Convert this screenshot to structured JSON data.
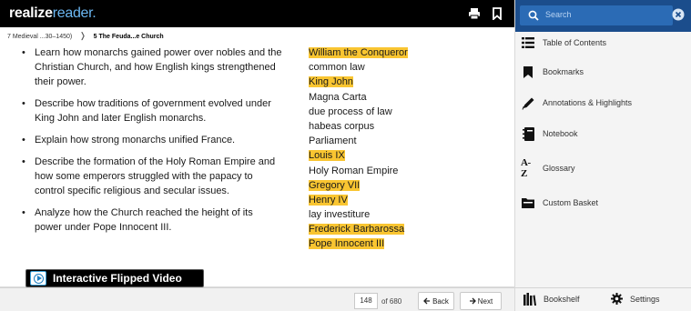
{
  "app": {
    "logo_part1": "realize",
    "logo_part2": "reader."
  },
  "breadcrumb": {
    "parent": "7 Medieval ...30–1450)",
    "separator": "❭",
    "current": "5 The Feuda...e Church"
  },
  "objectives": [
    "Learn how monarchs gained power over nobles and the Christian Church, and how English kings strengthened their power.",
    "Describe how traditions of government evolved under King John and later English monarchs.",
    "Explain how strong monarchs unified France.",
    "Describe the formation of the Holy Roman Empire and how some emperors struggled with the papacy to control specific religious and secular issues.",
    "Analyze how the Church reached the height of its power under Pope Innocent III."
  ],
  "terms": [
    {
      "text": "William the Conqueror",
      "highlighted": true
    },
    {
      "text": "common law",
      "highlighted": false
    },
    {
      "text": "King John",
      "highlighted": true
    },
    {
      "text": "Magna Carta",
      "highlighted": false
    },
    {
      "text": "due process of law",
      "highlighted": false
    },
    {
      "text": "habeas corpus",
      "highlighted": false
    },
    {
      "text": "Parliament",
      "highlighted": false
    },
    {
      "text": "Louis IX",
      "highlighted": true
    },
    {
      "text": "Holy Roman Empire",
      "highlighted": false
    },
    {
      "text": "Gregory VII",
      "highlighted": true
    },
    {
      "text": "Henry IV",
      "highlighted": true
    },
    {
      "text": "lay investiture",
      "highlighted": false
    },
    {
      "text": "Frederick Barbarossa",
      "highlighted": true
    },
    {
      "text": "Pope Innocent III",
      "highlighted": true
    }
  ],
  "video": {
    "label": "Interactive Flipped Video"
  },
  "pager": {
    "current_page": "148",
    "of_label": "of",
    "total_pages": "680",
    "back_label": "Back",
    "next_label": "Next"
  },
  "search": {
    "placeholder": "Search"
  },
  "panel_menu": [
    {
      "label": "Table of Contents",
      "icon": "list-icon"
    },
    {
      "label": "Bookmarks",
      "icon": "bookmark-icon"
    },
    {
      "label": "Annotations & Highlights",
      "icon": "pencil-icon"
    },
    {
      "label": "Notebook",
      "icon": "notebook-icon"
    },
    {
      "label": "Glossary",
      "icon": "az-icon"
    },
    {
      "label": "Custom Basket",
      "icon": "folder-icon"
    }
  ],
  "panel_bottom": {
    "bookshelf_label": "Bookshelf",
    "settings_label": "Settings"
  },
  "colors": {
    "topbar": "#000000",
    "logo_accent": "#6bb7f2",
    "highlight": "#f9c531",
    "search_bar": "#1b4d8c",
    "search_field": "#2b6bb5"
  }
}
